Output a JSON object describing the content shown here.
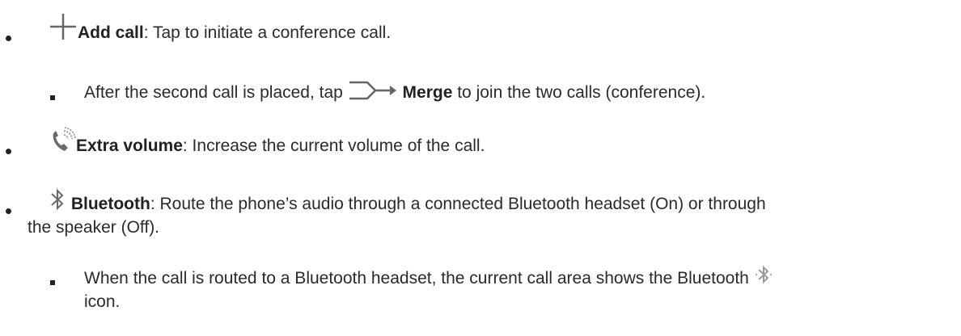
{
  "items": [
    {
      "icon": "plus-icon",
      "title": "Add call",
      "text": ": Tap to initiate a conference call."
    },
    {
      "pre": "After the second call is placed, tap ",
      "icon": "merge-icon",
      "title": "Merge",
      "text": " to join the two calls (conference)."
    },
    {
      "icon": "extra-volume-icon",
      "title": "Extra volume",
      "text": ": Increase the current volume of the call."
    },
    {
      "icon": "bluetooth-icon",
      "title": "Bluetooth",
      "text": ": Route the phone’s audio through a connected Bluetooth headset (On) or through",
      "text2": "the speaker (Off)."
    },
    {
      "text": "When the call is routed to a Bluetooth headset, the current call area shows the Bluetooth",
      "icon": "bluetooth-active-icon",
      "text2": "icon."
    }
  ],
  "colors": {
    "text": "#2a2a2a",
    "icon": "#6a6a6a",
    "icon_light": "#9a9a9a"
  }
}
